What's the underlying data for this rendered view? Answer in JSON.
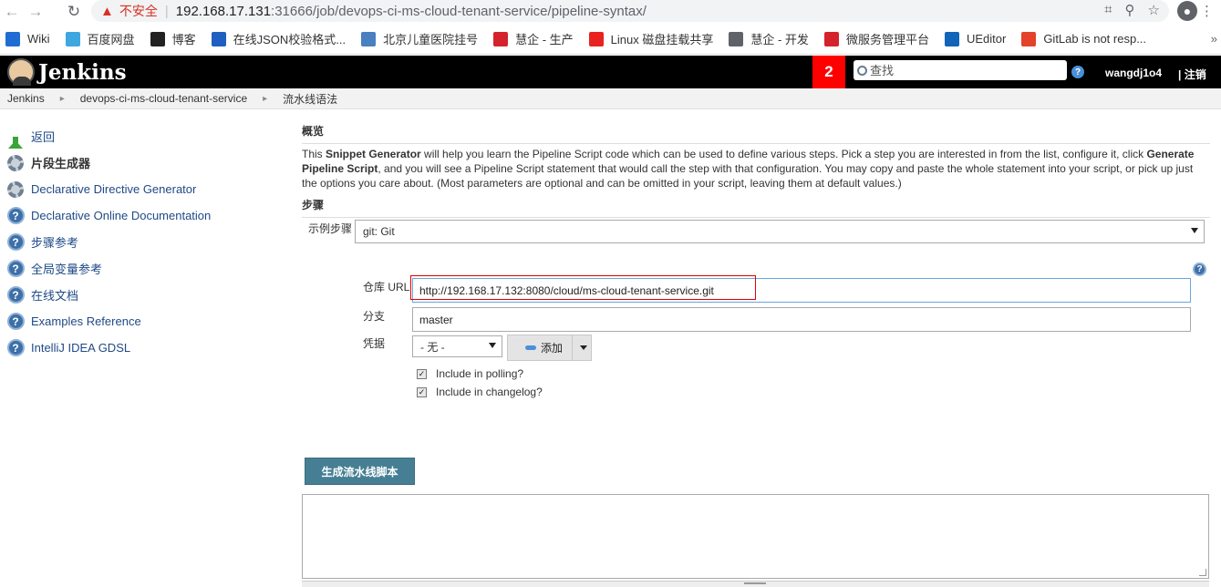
{
  "browser": {
    "security_label": "不安全",
    "url_host": "192.168.17.131",
    "url_rest": ":31666/job/devops-ci-ms-cloud-tenant-service/pipeline-syntax/",
    "bookmarks": [
      {
        "label": "Wiki",
        "icon": "confluence-icon",
        "color": "#1f6dd2"
      },
      {
        "label": "百度网盘",
        "icon": "baidu-cloud-icon",
        "color": "#3fa7e0"
      },
      {
        "label": "博客",
        "icon": "notion-icon",
        "color": "#222222"
      },
      {
        "label": "在线JSON校验格式...",
        "icon": "json-icon",
        "color": "#1f5fbf"
      },
      {
        "label": "北京儿童医院挂号",
        "icon": "hospital-icon",
        "color": "#4a7fc0"
      },
      {
        "label": "慧企 - 生产",
        "icon": "huiqi-icon",
        "color": "#d4232b"
      },
      {
        "label": "Linux 磁盘挂载共享",
        "icon": "csdn-icon",
        "color": "#e8231f"
      },
      {
        "label": "慧企 - 开发",
        "icon": "globe-icon",
        "color": "#5f6368"
      },
      {
        "label": "微服务管理平台",
        "icon": "huiqi-icon",
        "color": "#d4232b"
      },
      {
        "label": "UEditor",
        "icon": "ueditor-icon",
        "color": "#1264b8"
      },
      {
        "label": "GitLab is not resp...",
        "icon": "gitlab-icon",
        "color": "#e2432a"
      }
    ]
  },
  "header": {
    "title": "Jenkins",
    "badge_count": "2",
    "search_placeholder": "查找",
    "username": "wangdj1o4",
    "logout": "| 注销"
  },
  "breadcrumb": [
    "Jenkins",
    "devops-ci-ms-cloud-tenant-service",
    "流水线语法"
  ],
  "sidebar": {
    "items": [
      {
        "label": "返回",
        "icon": "up-arrow-icon"
      },
      {
        "label": "片段生成器",
        "icon": "gear-icon",
        "bold": true
      },
      {
        "label": "Declarative Directive Generator",
        "icon": "gear-icon"
      },
      {
        "label": "Declarative Online Documentation",
        "icon": "help-icon"
      },
      {
        "label": "步骤参考",
        "icon": "help-icon"
      },
      {
        "label": "全局变量参考",
        "icon": "help-icon"
      },
      {
        "label": "在线文档",
        "icon": "help-icon"
      },
      {
        "label": "Examples Reference",
        "icon": "help-icon"
      },
      {
        "label": "IntelliJ IDEA GDSL",
        "icon": "help-icon"
      }
    ]
  },
  "main": {
    "overview_title": "概览",
    "overview_p1": "This ",
    "overview_b1": "Snippet Generator",
    "overview_p2": " will help you learn the Pipeline Script code which can be used to define various steps. Pick a step you are interested in from the list, configure it, click ",
    "overview_b2": "Generate Pipeline Script",
    "overview_p3": ", and you will see a Pipeline Script statement that would call the step with that configuration. You may copy and paste the whole statement into your script, or pick up just the options you care about. (Most parameters are optional and can be omitted in your script, leaving them at default values.)",
    "steps_title": "步骤",
    "sample_step_label": "示例步骤",
    "sample_step_value": "git: Git",
    "repo_label": "仓库 URL",
    "repo_value": "http://192.168.17.132:8080/cloud/ms-cloud-tenant-service.git",
    "branch_label": "分支",
    "branch_value": "master",
    "credentials_label": "凭据",
    "credentials_value": "- 无 -",
    "add_label": "添加",
    "polling_label": "Include in polling?",
    "changelog_label": "Include in changelog?",
    "generate_label": "生成流水线脚本"
  }
}
